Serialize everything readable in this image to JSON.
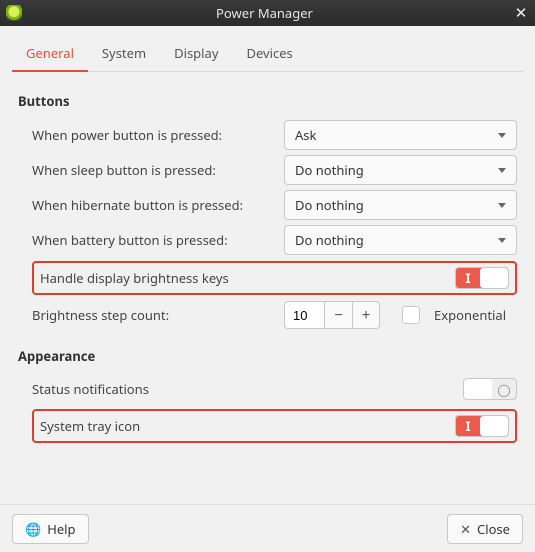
{
  "window": {
    "title": "Power Manager"
  },
  "tabs": [
    "General",
    "System",
    "Display",
    "Devices"
  ],
  "active_tab": "General",
  "sections": {
    "buttons": {
      "title": "Buttons",
      "rows": {
        "power": {
          "label": "When power button is pressed:",
          "value": "Ask"
        },
        "sleep": {
          "label": "When sleep button is pressed:",
          "value": "Do nothing"
        },
        "hibernate": {
          "label": "When hibernate button is pressed:",
          "value": "Do nothing"
        },
        "battery": {
          "label": "When battery button is pressed:",
          "value": "Do nothing"
        }
      },
      "brightness_keys": {
        "label": "Handle display brightness keys",
        "on": true
      },
      "brightness_step": {
        "label": "Brightness step count:",
        "value": "10",
        "exponential_label": "Exponential",
        "exponential": false
      }
    },
    "appearance": {
      "title": "Appearance",
      "status_notifications": {
        "label": "Status notifications",
        "on": false
      },
      "tray_icon": {
        "label": "System tray icon",
        "on": true
      }
    }
  },
  "footer": {
    "help": "Help",
    "close": "Close"
  }
}
